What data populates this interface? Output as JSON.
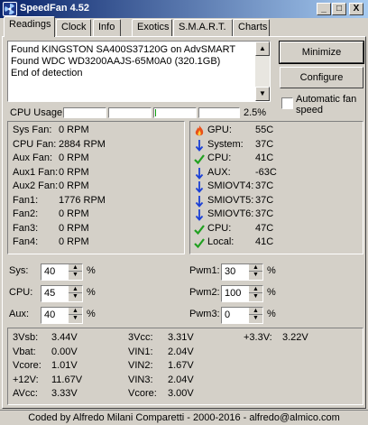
{
  "window": {
    "title": "SpeedFan 4.52",
    "minimize": "_",
    "maximize": "□",
    "close": "X"
  },
  "tabs": [
    "Readings",
    "Clock",
    "Info",
    "Exotics",
    "S.M.A.R.T.",
    "Charts"
  ],
  "log": [
    "Found KINGSTON SA400S37120G on AdvSMART",
    "Found WDC WD3200AAJS-65M0A0 (320.1GB)",
    "End of detection"
  ],
  "buttons": {
    "minimize": "Minimize",
    "configure": "Configure",
    "auto_fan_speed": "Automatic fan speed"
  },
  "cpu_usage": {
    "label": "CPU Usage",
    "value": "2.5%",
    "cores": [
      0.0,
      0.0,
      0.02,
      0.0
    ]
  },
  "fans": [
    {
      "label": "Sys Fan:",
      "value": "0 RPM"
    },
    {
      "label": "CPU Fan:",
      "value": "2884 RPM"
    },
    {
      "label": "Aux Fan:",
      "value": "0 RPM"
    },
    {
      "label": "Aux1 Fan:",
      "value": "0 RPM"
    },
    {
      "label": "Aux2 Fan:",
      "value": "0 RPM"
    },
    {
      "label": "Fan1:",
      "value": "1776 RPM"
    },
    {
      "label": "Fan2:",
      "value": "0 RPM"
    },
    {
      "label": "Fan3:",
      "value": "0 RPM"
    },
    {
      "label": "Fan4:",
      "value": "0 RPM"
    }
  ],
  "temps": [
    {
      "icon": "flame-icon",
      "label": "GPU:",
      "value": "55C"
    },
    {
      "icon": "down-arrow-icon",
      "label": "System:",
      "value": "37C"
    },
    {
      "icon": "checkmark-icon",
      "label": "CPU:",
      "value": "41C"
    },
    {
      "icon": "down-arrow-icon",
      "label": "AUX:",
      "value": "-63C"
    },
    {
      "icon": "down-arrow-icon",
      "label": "SMIOVT4:",
      "value": "37C"
    },
    {
      "icon": "down-arrow-icon",
      "label": "SMIOVT5:",
      "value": "37C"
    },
    {
      "icon": "down-arrow-icon",
      "label": "SMIOVT6:",
      "value": "37C"
    },
    {
      "icon": "checkmark-icon",
      "label": "CPU:",
      "value": "47C"
    },
    {
      "icon": "checkmark-icon",
      "label": "Local:",
      "value": "41C"
    }
  ],
  "speeds_left": [
    {
      "label": "Sys:",
      "value": "40",
      "unit": "%"
    },
    {
      "label": "CPU:",
      "value": "45",
      "unit": "%"
    },
    {
      "label": "Aux:",
      "value": "40",
      "unit": "%"
    }
  ],
  "speeds_right": [
    {
      "label": "Pwm1:",
      "value": "30",
      "unit": "%"
    },
    {
      "label": "Pwm2:",
      "value": "100",
      "unit": "%"
    },
    {
      "label": "Pwm3:",
      "value": "0",
      "unit": "%"
    }
  ],
  "voltages": {
    "col1": [
      {
        "label": "3Vsb:",
        "value": "3.44V"
      },
      {
        "label": "Vbat:",
        "value": "0.00V"
      },
      {
        "label": "Vcore:",
        "value": "1.01V"
      },
      {
        "label": "+12V:",
        "value": "11.67V"
      },
      {
        "label": "AVcc:",
        "value": "3.33V"
      }
    ],
    "col2": [
      {
        "label": "3Vcc:",
        "value": "3.31V"
      },
      {
        "label": "VIN1:",
        "value": "2.04V"
      },
      {
        "label": "VIN2:",
        "value": "1.67V"
      },
      {
        "label": "VIN3:",
        "value": "2.04V"
      },
      {
        "label": "Vcore:",
        "value": "3.00V"
      }
    ],
    "col3": [
      {
        "label": "+3.3V:",
        "value": "3.22V"
      }
    ]
  },
  "footer": "Coded by Alfredo Milani Comparetti - 2000-2016 - alfredo@almico.com",
  "colors": {
    "title_bar": "#0a246a",
    "flame": "#e8501a",
    "arrow": "#1a3fd6",
    "check": "#20a020"
  }
}
